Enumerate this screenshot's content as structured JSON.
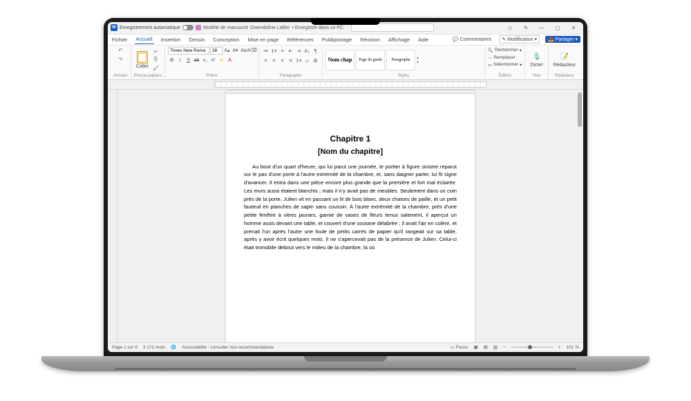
{
  "titlebar": {
    "autosave": "Enregistrement automatique",
    "doc_name": "Modèle de manuscrit",
    "user": "Gwendoline Lallier",
    "saved": "• Enregistré dans ce PC"
  },
  "menu": {
    "items": [
      "Fichier",
      "Accueil",
      "Insertion",
      "Dessin",
      "Conception",
      "Mise en page",
      "Références",
      "Publipostage",
      "Révision",
      "Affichage",
      "Aide"
    ],
    "comments": "Commentaires",
    "modification": "Modification",
    "share": "Partager"
  },
  "ribbon": {
    "paste": "Coller",
    "clipboard_label": "Presse-papiers",
    "font_name": "Times New Roma",
    "font_size": "28",
    "font_label": "Police",
    "para_label": "Paragraphe",
    "styles": {
      "s1": "Nom chap",
      "s2": "Page de garde",
      "s3": "Paragraphe"
    },
    "styles_label": "Styles",
    "edit": {
      "find": "Rechercher",
      "replace": "Remplacer",
      "select": "Sélectionner"
    },
    "edit_label": "Édition",
    "dictate": "Dicter",
    "voice_label": "Voix",
    "editor": "Rédacteur",
    "editor_label": "Rédacteur"
  },
  "document": {
    "chapter": "Chapitre 1",
    "subtitle": "[Nom du chapitre]",
    "body": "Au bout d'un quart d'heure, qui lui parut une journée, le portier à figure sinistre reparut sur le pas d'une porte à l'autre extrémité de la chambre, et, sans daigner parler, lui fit signe d'avancer. Il entra dans une pièce encore plus grande que la première et fort mal éclairée. Les murs aussi étaient blanchis ; mais il n'y avait pas de meubles. Seulement dans un coin près de la porte, Julien vit en passant un lit de bois blanc, deux chaises de paille, et un petit fauteuil en planches de sapin sans coussin. À l'autre extrémité de la chambre, près d'une petite fenêtre à vitres jaunies, garnie de vases de fleurs tenus salement, il aperçut un homme assis devant une table, et couvert d'une soutane délabrée ; il avait l'air en colère, et prenait l'un après l'autre une foule de petits carrés de papier qu'il rangeait sur sa table, après y avoir écrit quelques mots. Il ne s'apercevait pas de la présence de Julien. Celui-ci était immobile debout vers le milieu de la chambre, là où"
  },
  "status": {
    "page": "Page 1 sur 9",
    "words": "3 171 mots",
    "access": "Accessibilité : consulter nos recommandations",
    "focus": "Focus",
    "zoom": "101 %"
  }
}
